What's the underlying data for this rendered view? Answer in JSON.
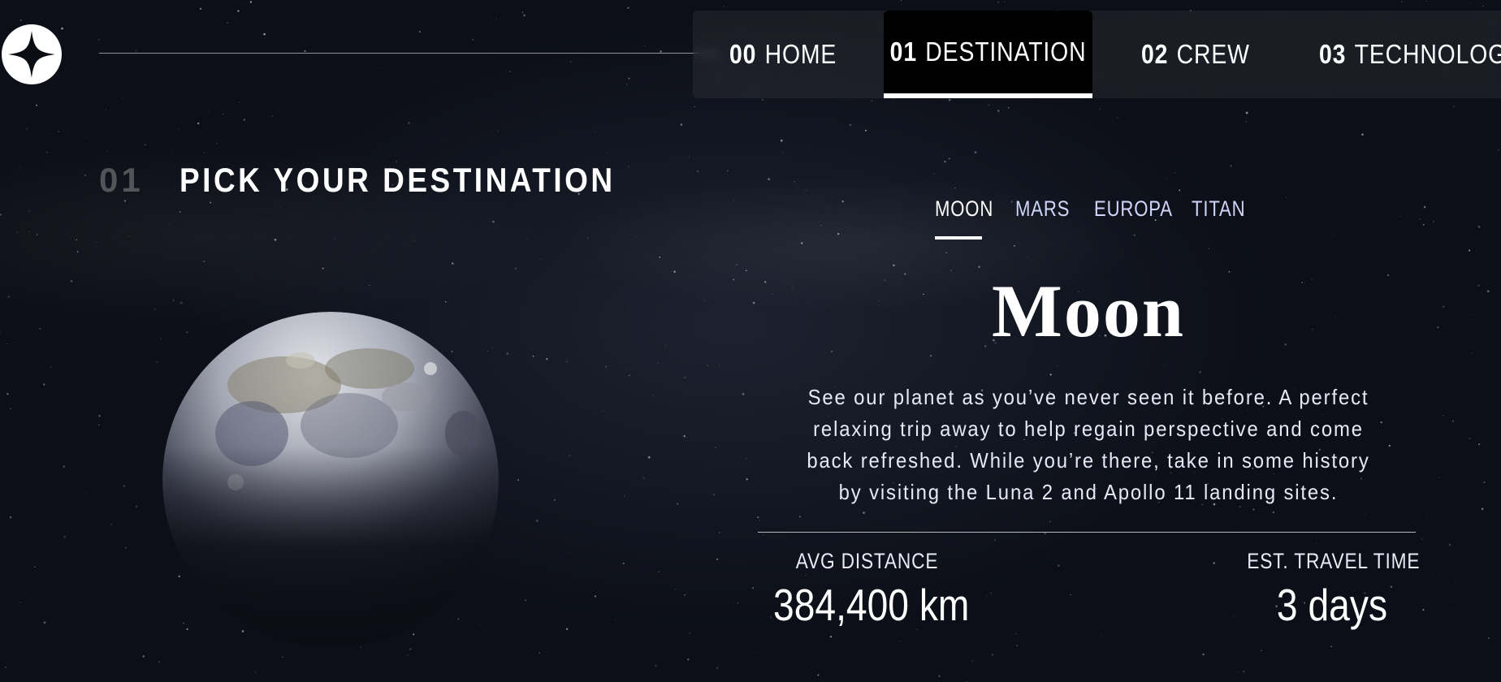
{
  "nav": {
    "items": [
      {
        "num": "00",
        "label": "HOME",
        "active": false
      },
      {
        "num": "01",
        "label": "DESTINATION",
        "active": true
      },
      {
        "num": "02",
        "label": "CREW",
        "active": false
      },
      {
        "num": "03",
        "label": "TECHNOLOGY",
        "active": false
      }
    ]
  },
  "page": {
    "number": "01",
    "heading": "PICK YOUR DESTINATION"
  },
  "destination": {
    "tabs": [
      "MOON",
      "MARS",
      "EUROPA",
      "TITAN"
    ],
    "selected_tab": "MOON",
    "name": "Moon",
    "description": "See our planet as you’ve never seen it before. A perfect relaxing trip away to help regain perspective and come back refreshed. While you’re there, take in some history by visiting the Luna 2 and Apollo 11 landing sites.",
    "stats": {
      "distance_label": "AVG DISTANCE",
      "distance_value": "384,400 km",
      "travel_label": "EST. TRAVEL TIME",
      "travel_value": "3 days"
    },
    "image_icon": "moon-image"
  },
  "colors": {
    "background": "#0b0d15",
    "text": "#ffffff",
    "tab_text": "#d0d6f9",
    "nav_active_bg": "#000000"
  }
}
